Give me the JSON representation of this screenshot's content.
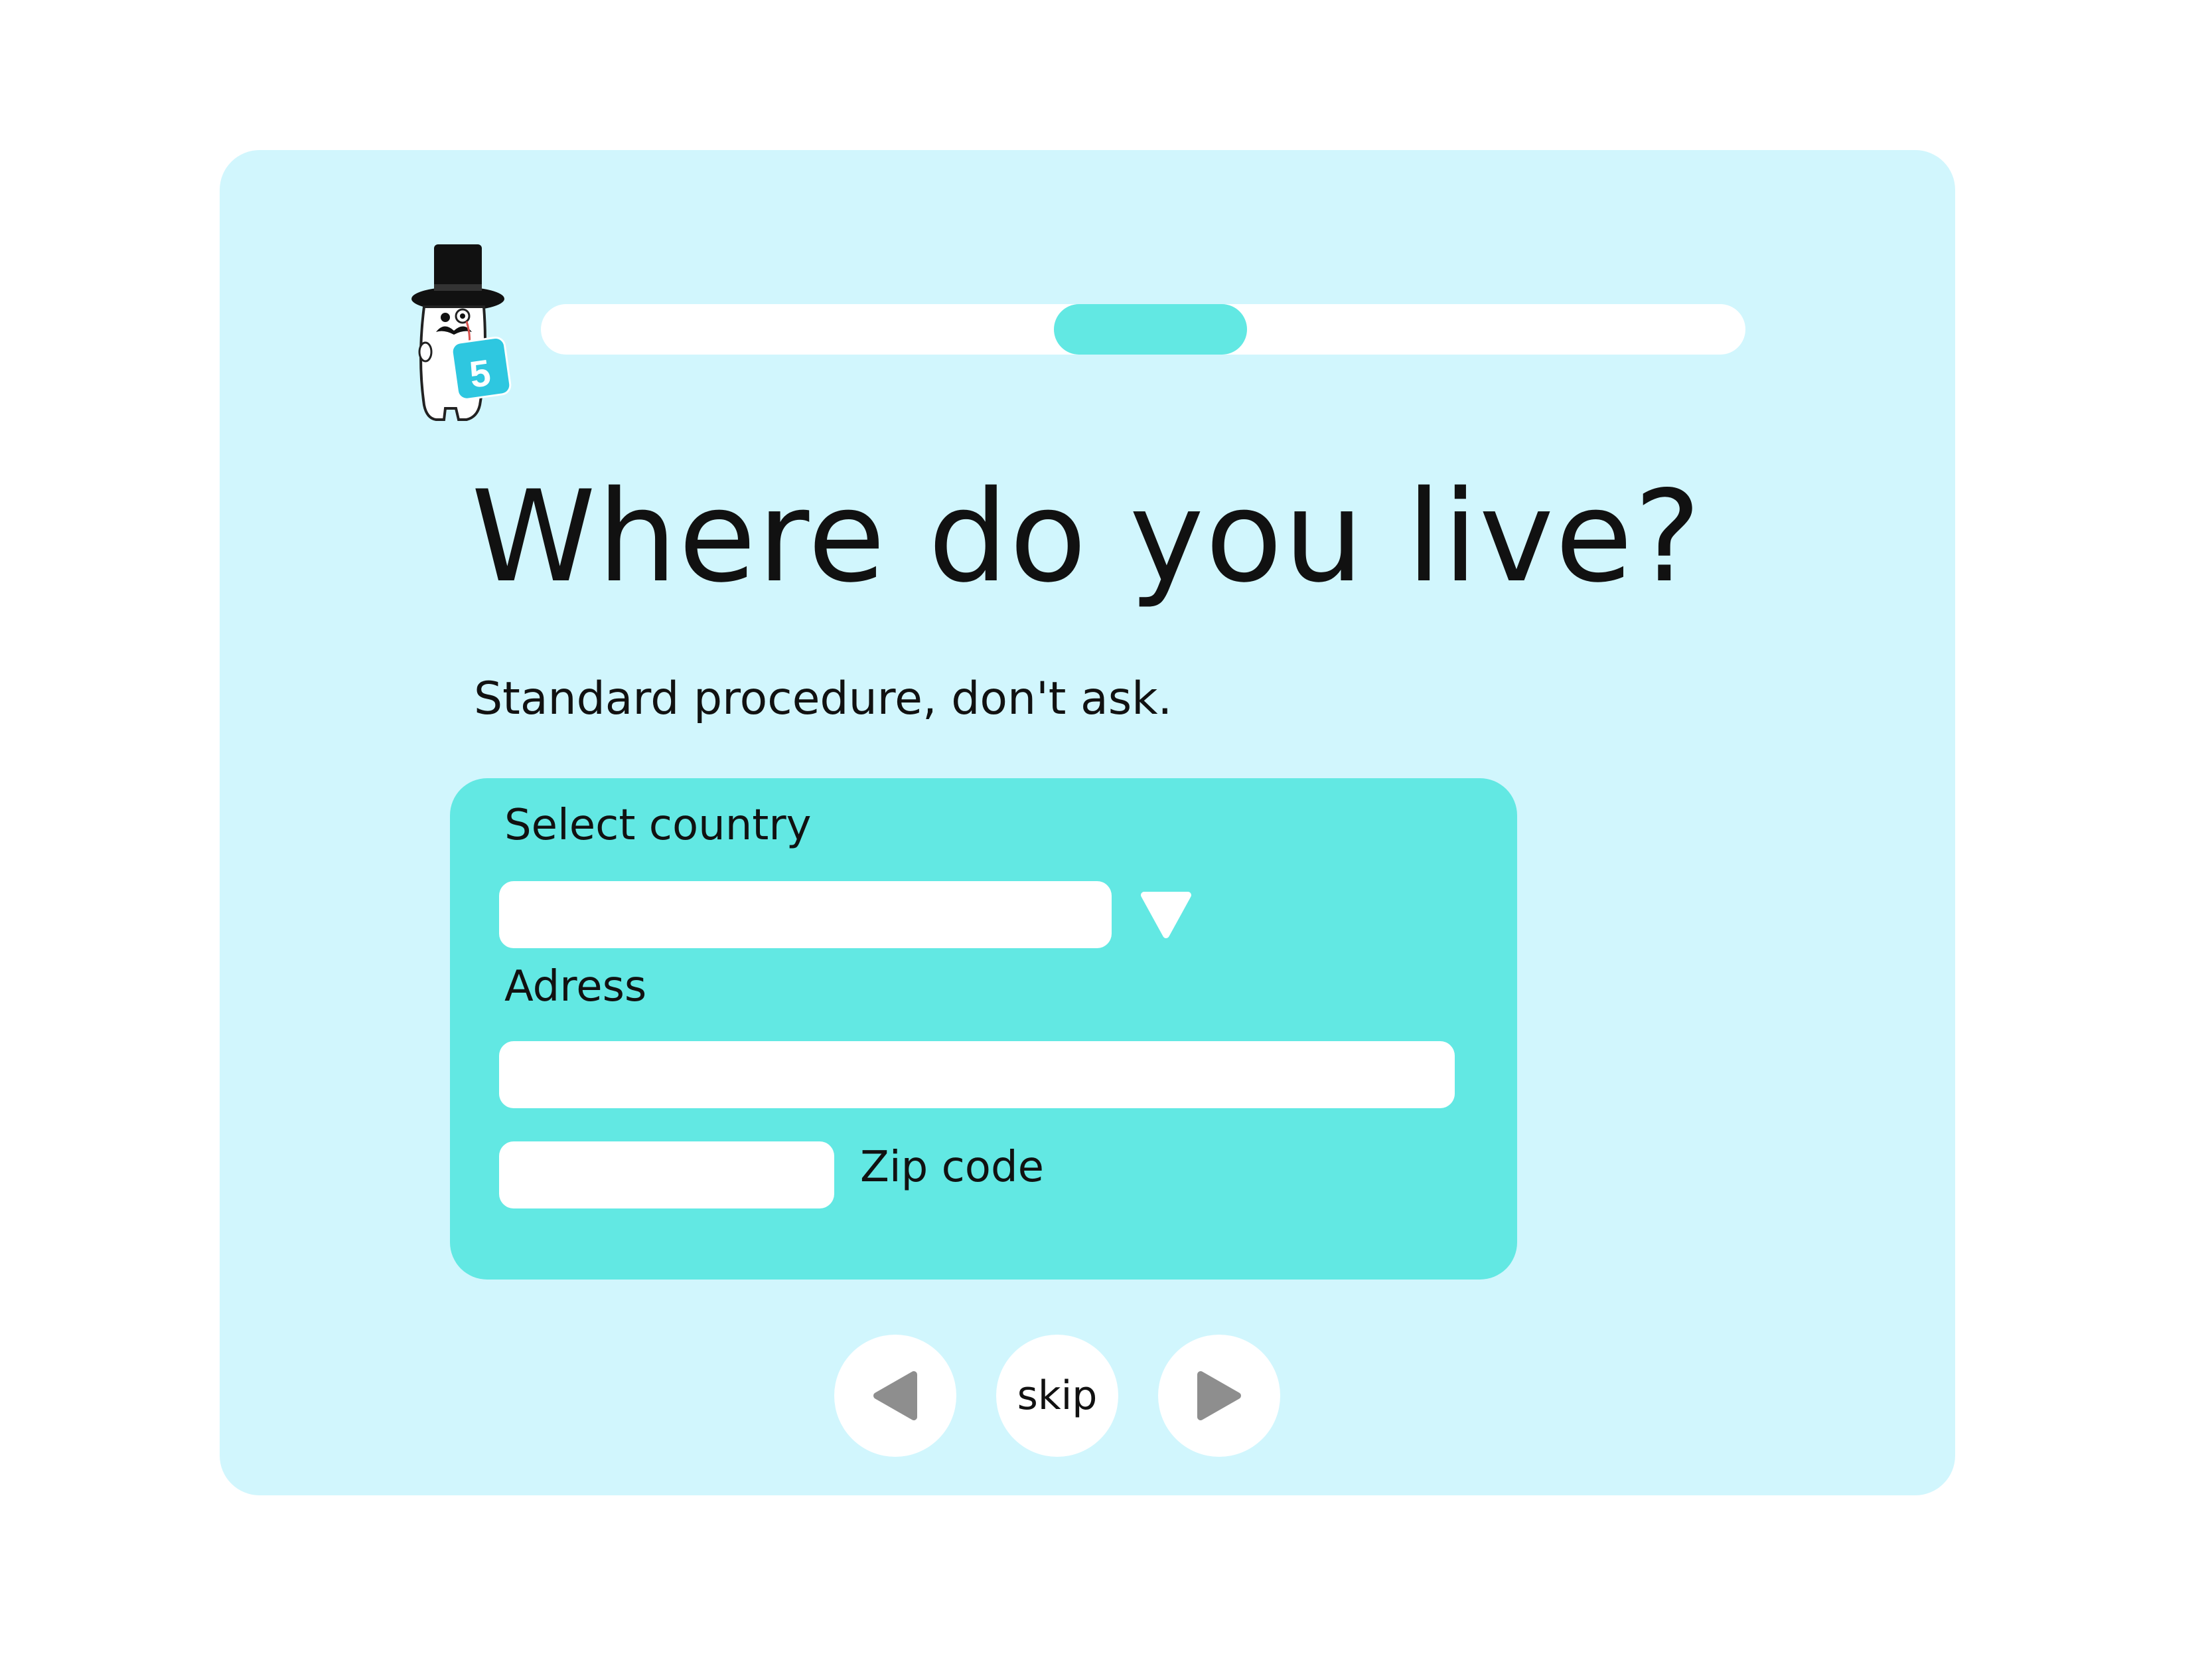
{
  "progress": {
    "fill_fraction": 0.16,
    "fill_offset_fraction": 0.426,
    "colors": {
      "track": "#ffffff",
      "fill": "#62e8e3"
    }
  },
  "mascot": {
    "icon": "top-hat-ghost-mascot-icon",
    "badge_number": "5"
  },
  "heading": {
    "title": "Where do you live?",
    "subtitle": "Standard procedure, don't ask."
  },
  "form": {
    "country_label": "Select country",
    "country_value": "",
    "country_dropdown_icon": "triangle-down-icon",
    "address_label": "Adress",
    "address_value": "",
    "zip_label": "Zip code",
    "zip_value": ""
  },
  "navigation": {
    "back_icon": "triangle-left-icon",
    "skip_label": "skip",
    "next_icon": "triangle-right-icon"
  },
  "colors": {
    "background": "#ffffff",
    "card": "#d1f6fd",
    "accent": "#62e8e3",
    "field": "#ffffff",
    "nav_arrow": "#8e8e8e"
  }
}
